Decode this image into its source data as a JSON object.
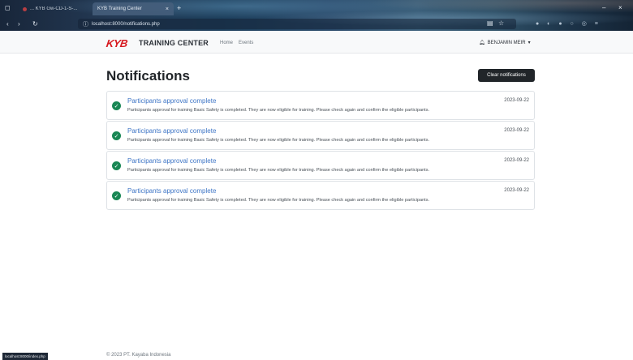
{
  "browser": {
    "tabs": [
      {
        "label": "... KYB Gw-CD-1-S-..."
      },
      {
        "label": "KYB Training Center"
      }
    ],
    "url": "localhost:8000/notifications.php",
    "new_tab_symbol": "+",
    "back_symbol": "‹",
    "forward_symbol": "›",
    "reload_symbol": "↻",
    "star_symbol": "☆"
  },
  "nav": {
    "logo": "KYB",
    "brand": "TRAINING CENTER",
    "links": [
      "Home",
      "Events"
    ],
    "user": "BENJAMIN MEIR"
  },
  "page": {
    "title": "Notifications",
    "clear_button": "Clear notifications"
  },
  "notifications": [
    {
      "title": "Participants approval complete",
      "date": "2023-09-22",
      "body": "Participants approval for training Basic Safety is completed. They are now eligible for training. Please check again and confirm the eligible participants."
    },
    {
      "title": "Participants approval complete",
      "date": "2023-09-22",
      "body": "Participants approval for training Basic Safety is completed. They are now eligible for training. Please check again and confirm the eligible participants."
    },
    {
      "title": "Participants approval complete",
      "date": "2023-09-22",
      "body": "Participants approval for training Basic Safety is completed. They are now eligible for training. Please check again and confirm the eligible participants."
    },
    {
      "title": "Participants approval complete",
      "date": "2023-09-22",
      "body": "Participants approval for training Basic Safety is completed. They are now eligible for training. Please check again and confirm the eligible participants."
    }
  ],
  "footer": {
    "copyright": "© 2023 PT. Kayaba Indonesia"
  },
  "status_bar": {
    "hover_url": "localhost:8000/index.php"
  },
  "colors": {
    "brand_red": "#d7191f",
    "link_blue": "#3f76c6",
    "success_green": "#198754",
    "button_dark": "#212529"
  }
}
